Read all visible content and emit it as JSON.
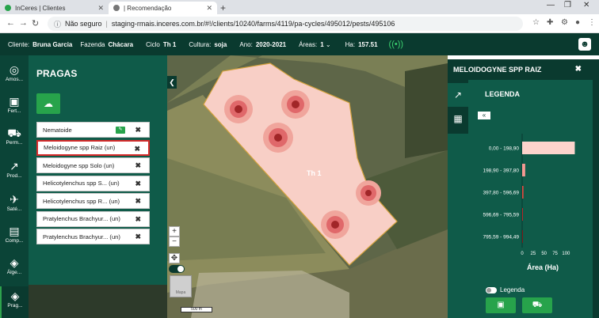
{
  "browser": {
    "tabs": [
      {
        "title": "InCeres | Clientes",
        "active": false
      },
      {
        "title": "| Recomendação",
        "active": true
      }
    ],
    "security": "Não seguro",
    "url": "staging-rmais.inceres.com.br/#!/clients/10240/farms/4119/pa-cycles/495012/pests/495106"
  },
  "header": {
    "client_label": "Cliente:",
    "client_value": "Bruna Garcia",
    "farm_label": "Fazenda",
    "farm_value": "Chácara",
    "cycle_label": "Ciclo",
    "cycle_value": "Th 1",
    "crop_label": "Cultura:",
    "crop_value": "soja",
    "year_label": "Ano:",
    "year_value": "2020-2021",
    "areas_label": "Áreas:",
    "areas_value": "1",
    "ha_label": "Ha:",
    "ha_value": "157.51"
  },
  "rail": [
    {
      "label": "Amos...",
      "icon": "sampling-icon"
    },
    {
      "label": "Fert...",
      "icon": "fertilizer-icon"
    },
    {
      "label": "Perm...",
      "icon": "permission-icon"
    },
    {
      "label": "Prod...",
      "icon": "production-chart-icon"
    },
    {
      "label": "Saté...",
      "icon": "satellite-icon"
    },
    {
      "label": "Comp...",
      "icon": "compare-icon"
    },
    {
      "label": "Álge...",
      "icon": "algebra-layers-icon"
    },
    {
      "label": "Prag...",
      "icon": "pests-layers-icon"
    }
  ],
  "pests": {
    "title": "PRAGAS",
    "items": [
      {
        "label": "Nematoide",
        "selected": false,
        "badge": true
      },
      {
        "label": "Meloidogyne spp Raiz (un)",
        "selected": true,
        "badge": false
      },
      {
        "label": "Meloidogyne spp Solo (un)",
        "selected": false,
        "badge": false
      },
      {
        "label": "Helicotylenchus spp S... (un)",
        "selected": false,
        "badge": false
      },
      {
        "label": "Helicotylenchus spp R... (un)",
        "selected": false,
        "badge": false
      },
      {
        "label": "Pratylenchus Brachyur... (un)",
        "selected": false,
        "badge": false
      },
      {
        "label": "Pratylenchus Brachyur... (un)",
        "selected": false,
        "badge": false
      }
    ]
  },
  "map": {
    "field_label": "Th 1",
    "scale_label": "500 m",
    "thumb_label": "Mapa"
  },
  "legend_panel": {
    "title": "MELOIDOGYNE SPP RAIZ",
    "legend_label": "LEGENDA",
    "toggle_label": "Legenda"
  },
  "chart_data": {
    "type": "bar",
    "orientation": "horizontal",
    "categories": [
      "0,00 - 198,90",
      "198,90 - 397,80",
      "397,80 - 596,69",
      "596,69 - 795,59",
      "795,59 - 994,49"
    ],
    "values": [
      120,
      7,
      3,
      1.5,
      1
    ],
    "colors": [
      "#fcd4cc",
      "#f59a93",
      "#e0483f",
      "#b8282a",
      "#7a1a1a"
    ],
    "xlabel": "Área (Ha)",
    "xticks": [
      0,
      25,
      50,
      75,
      100
    ],
    "xlim": [
      0,
      130
    ]
  }
}
